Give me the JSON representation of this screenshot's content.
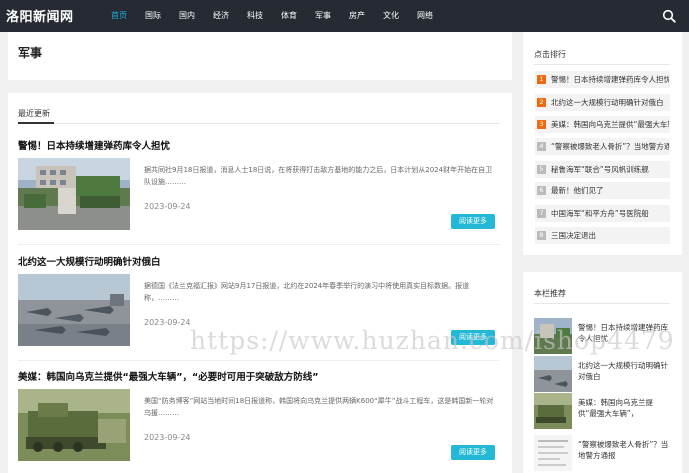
{
  "site": {
    "logo": "洛阳新闻网"
  },
  "nav": {
    "items": [
      "首页",
      "国际",
      "国内",
      "经济",
      "科技",
      "体育",
      "军事",
      "房产",
      "文化",
      "网络"
    ],
    "active_index": 0
  },
  "search": {
    "icon": "search-icon"
  },
  "category": {
    "title": "军事"
  },
  "latest": {
    "label": "最近更新",
    "articles": [
      {
        "title": "警惕！日本持续增建弹药库令人担忧",
        "summary": "据共同社9月18日报道，消息人士18日说，在将获得打击敌方基地的能力之后，日本计划从2024财年开始在自卫队设施………",
        "date": "2023-09-24",
        "button": "阅读更多"
      },
      {
        "title": "北约这一大规模行动明确针对俄白",
        "summary": "据德国《法兰克福汇报》网站9月17日报道，北约在2024年春季举行的演习中将使用真实目标数据。报道称，………",
        "date": "2023-09-24",
        "button": "阅读更多"
      },
      {
        "title": "美媒：韩国向乌克兰提供“最强大车辆”，“必要时可用于突破敌方防线”",
        "summary": "美国“防务博客”网站当地时间18日报道称，韩国将向乌克兰提供两辆K600“犀牛”战斗工程车，这是韩国新一轮对乌援………",
        "date": "2023-09-24",
        "button": "阅读更多"
      }
    ]
  },
  "ranking": {
    "title": "点击排行",
    "items": [
      {
        "num": "1",
        "text": "警惕！日本持续增建弹药库令人担忧"
      },
      {
        "num": "2",
        "text": "北约这一大规模行动明确针对俄白"
      },
      {
        "num": "3",
        "text": "美媒：韩国向乌克兰提供“最强大车辆”"
      },
      {
        "num": "4",
        "text": "“警察被爆致老人骨折”？当地警方通报"
      },
      {
        "num": "5",
        "text": "秘鲁海军“联合”号风帆训练舰"
      },
      {
        "num": "6",
        "text": "最新！他们见了"
      },
      {
        "num": "7",
        "text": "中国海军“和平方舟”号医院船"
      },
      {
        "num": "8",
        "text": "三国决定退出"
      }
    ]
  },
  "recommend": {
    "title": "本栏推荐",
    "items": [
      {
        "text": "警惕！日本持续增建弹药库令人担忧"
      },
      {
        "text": "北约这一大规模行动明确针对俄白"
      },
      {
        "text": "美媒：韩国向乌克兰提供“最强大车辆”，"
      },
      {
        "text": "“警察被爆致老人骨折”？当地警方通报"
      }
    ]
  },
  "watermark": {
    "text": "https://www.huzhan.com/ishop4479"
  },
  "colors": {
    "topbar": "#262b33",
    "accent": "#19b3e6",
    "button": "#22b8d6",
    "rank_hot": "#f06a0f"
  }
}
